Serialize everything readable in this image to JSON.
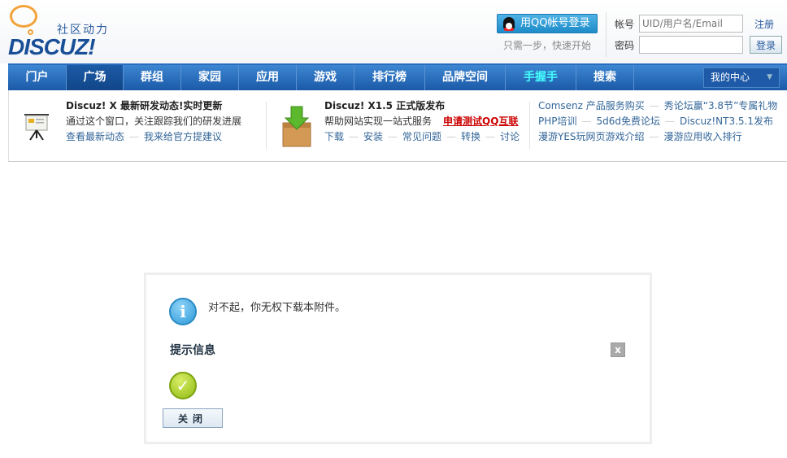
{
  "header": {
    "logo_slogan": "社区动力",
    "logo_word": "DISCUZ!",
    "qq_login": "用QQ帐号登录",
    "qq_tip": "只需一步，快速开始",
    "account_label": "帐号",
    "account_placeholder": "UID/用户名/Email",
    "password_label": "密码",
    "register": "注册",
    "login": "登录"
  },
  "nav": {
    "items": [
      "门户",
      "广场",
      "群组",
      "家园",
      "应用",
      "游戏",
      "排行榜",
      "品牌空间",
      "手握手",
      "搜索"
    ],
    "active": "广场",
    "my_center": "我的中心"
  },
  "info": {
    "col1": {
      "title_a": "Discuz! X ",
      "title_red": "最新研发动态",
      "title_b": "!实时更新",
      "desc": "通过这个窗口，关注跟踪我们的研发进展",
      "links": [
        "查看最新动态",
        "我来给官方提建议"
      ]
    },
    "col2": {
      "title": "Discuz! X1.5 正式版发布",
      "desc": "帮助网站实现一站式服务",
      "red_link": "申请测试QQ互联",
      "links": [
        "下载",
        "安装",
        "常见问题",
        "转换",
        "讨论"
      ]
    },
    "col3": {
      "row1": [
        "Comsenz 产品服务购买",
        "秀论坛赢“3.8节”专属礼物"
      ],
      "row2": [
        "PHP培训",
        "5d6d免费论坛",
        "Discuz!NT3.5.1发布"
      ],
      "row3": [
        "漫游YES玩网页游戏介绍",
        "漫游应用收入排行"
      ]
    }
  },
  "dialog": {
    "message": "对不起，你无权下载本附件。",
    "title": "提示信息",
    "close_x": "x",
    "close_button": "关闭"
  },
  "colors": {
    "nav": "#1b5aa8",
    "link": "#336699",
    "red": "#cc0000"
  }
}
